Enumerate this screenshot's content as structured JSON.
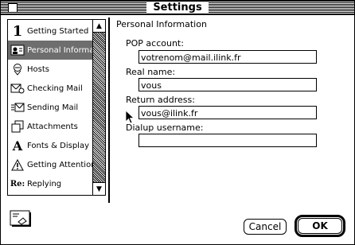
{
  "window": {
    "title": "Settings"
  },
  "sidebar": {
    "items": [
      {
        "label": "Getting Started",
        "icon": "number-one-icon",
        "selected": false
      },
      {
        "label": "Personal Informa",
        "icon": "personal-card-icon",
        "selected": true
      },
      {
        "label": "Hosts",
        "icon": "hosts-icon",
        "selected": false
      },
      {
        "label": "Checking Mail",
        "icon": "checking-mail-icon",
        "selected": false
      },
      {
        "label": "Sending Mail",
        "icon": "sending-mail-icon",
        "selected": false
      },
      {
        "label": "Attachments",
        "icon": "attachments-icon",
        "selected": false
      },
      {
        "label": "Fonts & Display",
        "icon": "font-a-icon",
        "selected": false
      },
      {
        "label": "Getting Attention",
        "icon": "warning-icon",
        "selected": false
      },
      {
        "label": "Replying",
        "icon": "reply-re-icon",
        "selected": false
      }
    ]
  },
  "panel": {
    "section_title": "Personal Information",
    "pop_account": {
      "label": "POP account:",
      "value": "votrenom@mail.ilink.fr"
    },
    "real_name": {
      "label": "Real name:",
      "value": "vous"
    },
    "return_address": {
      "label": "Return address:",
      "value": "vous@ilink.fr"
    },
    "dialup_username": {
      "label": "Dialup username:",
      "value": ""
    }
  },
  "buttons": {
    "cancel": "Cancel",
    "ok": "OK"
  },
  "icons": {
    "number_one_glyph": "1",
    "fonts_glyph": "A",
    "reply_glyph": "Re:"
  }
}
